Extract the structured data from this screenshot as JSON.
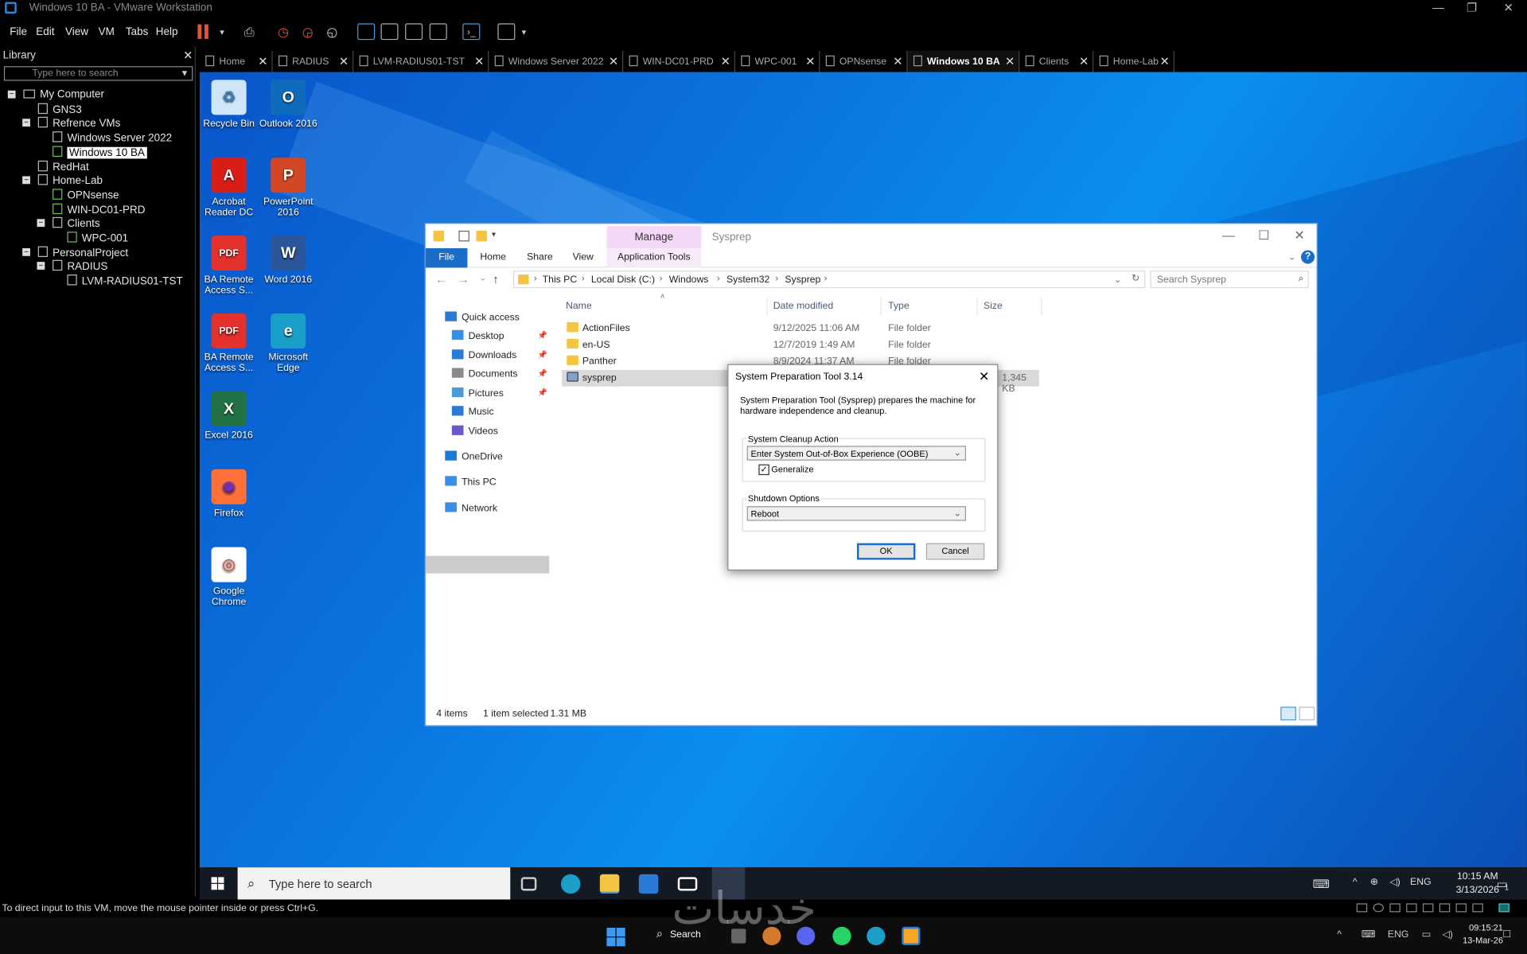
{
  "vmware": {
    "window_title": "Windows 10 BA - VMware Workstation",
    "menu": [
      "File",
      "Edit",
      "View",
      "VM",
      "Tabs",
      "Help"
    ],
    "status_message": "To direct input to this VM, move the mouse pointer inside or press Ctrl+G."
  },
  "library": {
    "title": "Library",
    "search_placeholder": "Type here to search",
    "tree": [
      {
        "label": "My Computer",
        "level": 0,
        "expander": "−"
      },
      {
        "label": "GNS3",
        "level": 1
      },
      {
        "label": "Refrence VMs",
        "level": 1,
        "expander": "−"
      },
      {
        "label": "Windows Server 2022",
        "level": 2
      },
      {
        "label": "Windows 10 BA",
        "level": 2,
        "selected": true,
        "running": true
      },
      {
        "label": "RedHat",
        "level": 1
      },
      {
        "label": "Home-Lab",
        "level": 1,
        "expander": "−"
      },
      {
        "label": "OPNsense",
        "level": 2,
        "running": true
      },
      {
        "label": "WIN-DC01-PRD",
        "level": 2,
        "running": true
      },
      {
        "label": "Clients",
        "level": 2,
        "expander": "−"
      },
      {
        "label": "WPC-001",
        "level": 3,
        "running": true
      },
      {
        "label": "PersonalProject",
        "level": 1,
        "expander": "−"
      },
      {
        "label": "RADIUS",
        "level": 2,
        "expander": "−"
      },
      {
        "label": "LVM-RADIUS01-TST",
        "level": 3
      }
    ]
  },
  "tabs": [
    {
      "label": "Home"
    },
    {
      "label": "RADIUS"
    },
    {
      "label": "LVM-RADIUS01-TST"
    },
    {
      "label": "Windows Server 2022"
    },
    {
      "label": "WIN-DC01-PRD"
    },
    {
      "label": "WPC-001"
    },
    {
      "label": "OPNsense"
    },
    {
      "label": "Windows 10 BA",
      "active": true
    },
    {
      "label": "Clients"
    },
    {
      "label": "Home-Lab"
    }
  ],
  "desktop_icons": [
    {
      "label": "Recycle Bin",
      "glyph": "♻",
      "bg": "#cfe6f7",
      "fg": "#3a7fc0"
    },
    {
      "label": "Outlook 2016",
      "glyph": "O",
      "bg": "#0f6cbd",
      "fg": "#ffffff"
    },
    {
      "label": "Acrobat Reader DC",
      "glyph": "A",
      "bg": "#d91e18",
      "fg": "#ffffff"
    },
    {
      "label": "PowerPoint 2016",
      "glyph": "P",
      "bg": "#d24726",
      "fg": "#ffffff"
    },
    {
      "label": "BA Remote Access S...",
      "glyph": "PDF",
      "bg": "#e3312d",
      "fg": "#ffffff"
    },
    {
      "label": "Word 2016",
      "glyph": "W",
      "bg": "#2b579a",
      "fg": "#ffffff"
    },
    {
      "label": "BA Remote Access S...",
      "glyph": "PDF",
      "bg": "#e3312d",
      "fg": "#ffffff"
    },
    {
      "label": "Microsoft Edge",
      "glyph": "e",
      "bg": "#1aa0c8",
      "fg": "#ffffff"
    },
    {
      "label": "Excel 2016",
      "glyph": "X",
      "bg": "#217346",
      "fg": "#ffffff"
    },
    {
      "label": "Firefox",
      "glyph": "◉",
      "bg": "#ff7139",
      "fg": "#6a2ecc"
    },
    {
      "label": "Google Chrome",
      "glyph": "◎",
      "bg": "#ffffff",
      "fg": "#db4437"
    }
  ],
  "explorer": {
    "title": "Sysprep",
    "contextual_tab_group": "Manage",
    "ribbon_tabs": [
      "File",
      "Home",
      "Share",
      "View",
      "Application Tools"
    ],
    "breadcrumbs": [
      "This PC",
      "Local Disk (C:)",
      "Windows",
      "System32",
      "Sysprep"
    ],
    "search_placeholder": "Search Sysprep",
    "nav": [
      {
        "label": "Quick access",
        "icon": "star-icon",
        "color": "#2b7ad6",
        "pinned": false
      },
      {
        "label": "Desktop",
        "icon": "desktop-folder-icon",
        "color": "#3a8ee6",
        "pinned": true
      },
      {
        "label": "Downloads",
        "icon": "download-icon",
        "color": "#2b7ad6",
        "pinned": true
      },
      {
        "label": "Documents",
        "icon": "documents-icon",
        "color": "#8a8a8a",
        "pinned": true
      },
      {
        "label": "Pictures",
        "icon": "pictures-icon",
        "color": "#4a9ad8",
        "pinned": true
      },
      {
        "label": "Music",
        "icon": "music-icon",
        "color": "#2b7ad6",
        "pinned": false
      },
      {
        "label": "Videos",
        "icon": "videos-icon",
        "color": "#6a5ac8",
        "pinned": false
      },
      {
        "label": "OneDrive",
        "icon": "cloud-icon",
        "color": "#1a7ad6",
        "pinned": false
      },
      {
        "label": "This PC",
        "icon": "computer-icon",
        "color": "#3a8ee6",
        "pinned": false,
        "selected": true
      },
      {
        "label": "Network",
        "icon": "network-icon",
        "color": "#3a8ee6",
        "pinned": false
      }
    ],
    "columns": [
      "Name",
      "Date modified",
      "Type",
      "Size"
    ],
    "files": [
      {
        "name": "ActionFiles",
        "date": "9/12/2025 11:06 AM",
        "type": "File folder"
      },
      {
        "name": "en-US",
        "date": "12/7/2019 1:49 AM",
        "type": "File folder"
      },
      {
        "name": "Panther",
        "date": "8/9/2024 11:37 AM",
        "type": "File folder"
      },
      {
        "name": "sysprep",
        "size": "1,345 KB",
        "selected": true
      }
    ],
    "status": {
      "items": "4 items",
      "selected": "1 item selected",
      "size": "1.31 MB"
    }
  },
  "sysprep_dialog": {
    "title": "System Preparation Tool 3.14",
    "description": "System Preparation Tool (Sysprep) prepares the machine for hardware independence and cleanup.",
    "cleanup_label": "System Cleanup Action",
    "cleanup_value": "Enter System Out-of-Box Experience (OOBE)",
    "generalize_label": "Generalize",
    "generalize_checked": true,
    "shutdown_label": "Shutdown Options",
    "shutdown_value": "Reboot",
    "ok_label": "OK",
    "cancel_label": "Cancel"
  },
  "guest_taskbar": {
    "search_placeholder": "Type here to search",
    "language": "ENG",
    "time": "10:15 AM",
    "date": "3/13/2026",
    "notification_count": "1"
  },
  "host_taskbar": {
    "search_label": "Search",
    "language": "ENG",
    "time": "09:15:21",
    "date": "13-Mar-26"
  },
  "watermark": "خدسات"
}
